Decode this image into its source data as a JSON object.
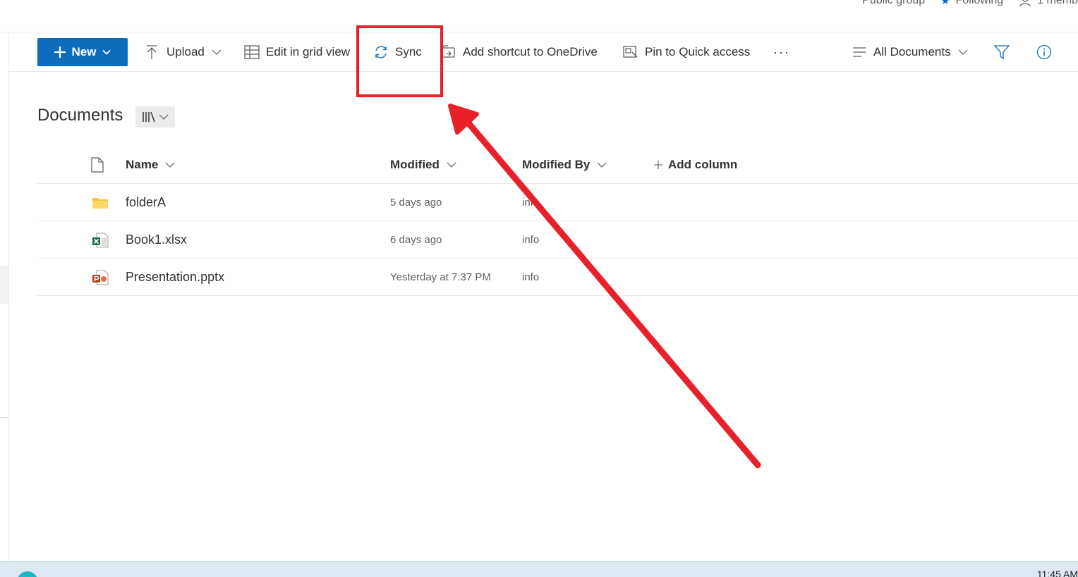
{
  "header": {
    "group_type": "Public group",
    "following_label": "Following",
    "members_label": "1 memb"
  },
  "toolbar": {
    "new_label": "New",
    "upload_label": "Upload",
    "grid_view_label": "Edit in grid view",
    "sync_label": "Sync",
    "shortcut_label": "Add shortcut to OneDrive",
    "pin_label": "Pin to Quick access",
    "more_label": "···",
    "view_label": "All Documents"
  },
  "library": {
    "title": "Documents"
  },
  "table": {
    "headers": {
      "name": "Name",
      "modified": "Modified",
      "modified_by": "Modified By",
      "add_column": "Add column"
    },
    "rows": [
      {
        "icon": "folder-icon",
        "name": "folderA",
        "modified": "5 days ago",
        "modified_by": "info"
      },
      {
        "icon": "excel-file-icon",
        "name": "Book1.xlsx",
        "modified": "6 days ago",
        "modified_by": "info"
      },
      {
        "icon": "powerpoint-file-icon",
        "name": "Presentation.pptx",
        "modified": "Yesterday at 7:37 PM",
        "modified_by": "info"
      }
    ]
  },
  "taskbar": {
    "time": "11:45 AM"
  },
  "colors": {
    "accent": "#0f6cbd",
    "annotation": "#e8202a",
    "folder": "#f6c33c",
    "excel": "#1d7044",
    "powerpoint": "#c43e1c"
  }
}
